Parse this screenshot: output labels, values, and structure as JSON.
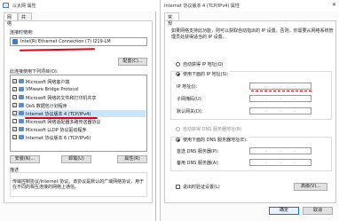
{
  "left": {
    "title": "以太网 属性",
    "tabs": [
      "网络",
      "共享"
    ],
    "connect_using_label": "连接时使用:",
    "adapter": "Intel(R) Ethernet Connection (7) I219-LM",
    "configure_button": "配置(C)...",
    "items_label": "此连接使用下列项目(O):",
    "items": [
      {
        "label": "Microsoft 网络客户端",
        "checked": true
      },
      {
        "label": "VMware Bridge Protocol",
        "checked": true
      },
      {
        "label": "Microsoft 网络的文件和打印机共享",
        "checked": true
      },
      {
        "label": "QoS 数据包计划程序",
        "checked": true
      },
      {
        "label": "Internet 协议版本 4 (TCP/IPv4)",
        "checked": true
      },
      {
        "label": "Microsoft 网络适配器多路传送器协议",
        "checked": false
      },
      {
        "label": "Microsoft LLDP 协议驱动程序",
        "checked": true
      },
      {
        "label": "Internet 协议版本 6 (TCP/IPv6)",
        "checked": true
      }
    ],
    "install_button": "安装(N)...",
    "uninstall_button": "卸载(U)",
    "properties_button": "属性(R)",
    "description_label": "描述",
    "description": "传输控制协议/Internet 协议。该协议是默认的广域网络协议，用于在不同的相互连接的网络上通信。"
  },
  "right": {
    "title": "Internet 协议版本 4 (TCP/IPv4) 属性",
    "tab": "常规",
    "intro": "如果网络支持此功能，则可以获取自动指派的 IP 设置。否则，你需要从网络系统管理员处获得适当的 IP 设置。",
    "auto_ip": "自动获得 IP 地址(O)",
    "manual_ip": "使用下面的 IP 地址(S):",
    "ip_label": "IP 地址(I):",
    "subnet_label": "子网掩码(U):",
    "gateway_label": "默认网关(D):",
    "auto_dns": "自动获得 DNS 服务器地址(B)",
    "manual_dns": "使用下面的 DNS 服务器地址(E):",
    "preferred_dns_label": "首选 DNS 服务器(P):",
    "alternate_dns_label": "备用 DNS 服务器(A):",
    "validate_label": "退出时验证设置(L)",
    "advanced_button": "高级(V)...",
    "ok_button": "确定",
    "cancel_button": "取消",
    "ip_dot": "."
  },
  "colors": {
    "accent": "#0078d7",
    "annotation": "#e0001a"
  }
}
